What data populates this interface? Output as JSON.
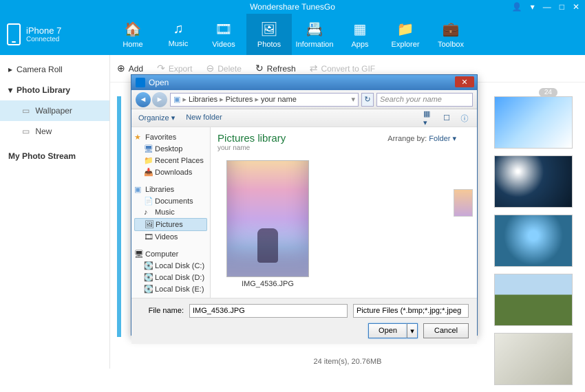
{
  "app": {
    "title": "Wondershare TunesGo"
  },
  "device": {
    "name": "iPhone 7",
    "status": "Connected"
  },
  "nav": {
    "home": "Home",
    "music": "Music",
    "videos": "Videos",
    "photos": "Photos",
    "information": "Information",
    "apps": "Apps",
    "explorer": "Explorer",
    "toolbox": "Toolbox"
  },
  "toolbar": {
    "add": "Add",
    "export": "Export",
    "delete": "Delete",
    "refresh": "Refresh",
    "gif": "Convert to GIF"
  },
  "sidebar": {
    "camera_roll": "Camera Roll",
    "photo_library": "Photo Library",
    "wallpaper": "Wallpaper",
    "new": "New",
    "stream": "My Photo Stream"
  },
  "badge_count": "24",
  "statusbar": "24 item(s), 20.76MB",
  "dialog": {
    "title": "Open",
    "breadcrumb": {
      "root": "Libraries",
      "lib": "Pictures",
      "folder": "your name"
    },
    "search_placeholder": "Search your name",
    "organize": "Organize",
    "new_folder": "New folder",
    "library_title": "Pictures library",
    "library_sub": "your name",
    "arrange_label": "Arrange by:",
    "arrange_value": "Folder",
    "tree": {
      "favorites": "Favorites",
      "desktop": "Desktop",
      "recent": "Recent Places",
      "downloads": "Downloads",
      "libraries": "Libraries",
      "documents": "Documents",
      "music": "Music",
      "pictures": "Pictures",
      "videos": "Videos",
      "computer": "Computer",
      "disk_c": "Local Disk (C:)",
      "disk_d": "Local Disk (D:)",
      "disk_e": "Local Disk (E:)"
    },
    "selected_file": "IMG_4536.JPG",
    "file_name_label": "File name:",
    "file_name_value": "IMG_4536.JPG",
    "filter": "Picture Files (*.bmp;*.jpg;*.jpeg",
    "open": "Open",
    "cancel": "Cancel"
  }
}
